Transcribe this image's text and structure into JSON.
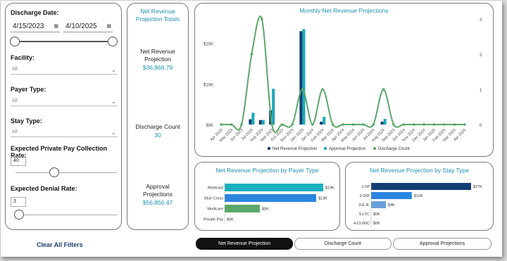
{
  "filters": {
    "discharge_date_label": "Discharge Date:",
    "start_date": "4/15/2023",
    "end_date": "4/10/2025",
    "facility_label": "Facility:",
    "facility_value": "All",
    "payer_label": "Payer Type:",
    "payer_value": "All",
    "stay_label": "Stay Type:",
    "stay_value": "All",
    "private_pay_label": "Expected Private Pay Collection Rate:",
    "private_pay_value": "40",
    "denial_label": "Expected Denial Rate:",
    "denial_value": "3",
    "clear_label": "Clear All Filters"
  },
  "totals": {
    "title": "Net Revenue Projection Totals",
    "nrp_label": "Net Revenue Projection",
    "nrp_value": "$36,868.79",
    "discharge_label": "Discharge Count",
    "discharge_value": "30",
    "approval_label": "Approval Projections",
    "approval_value": "$56,856.47"
  },
  "tabs": [
    "Net Revenue Projection",
    "Discharge Count",
    "Approval Projections"
  ],
  "colors": {
    "nrp": "#133e73",
    "approval": "#1aa8b8",
    "discharge": "#5aa86a",
    "accent": "#1a8fb0"
  },
  "chart_data": [
    {
      "type": "bar",
      "title": "Monthly Net Revenue Projections",
      "categories": [
        "Apr 2023",
        "May 2023",
        "Jun 2023",
        "Jul 2023",
        "Aug 2023",
        "Sep 2023",
        "Oct 2023",
        "Nov 2023",
        "Dec 2023",
        "Jan 2024",
        "Feb 2024",
        "Mar 2024",
        "Apr 2024",
        "May 2024",
        "Jun 2024",
        "Jul 2024",
        "Aug 2024",
        "Sep 2024",
        "Oct 2024",
        "Nov 2024",
        "Dec 2024",
        "Jan 2025",
        "Feb 2025",
        "Mar 2025",
        "Apr 2025"
      ],
      "series": [
        {
          "name": "Net Revenue Projection",
          "axis": "left",
          "values": [
            0,
            0,
            0,
            1300,
            1100,
            3500,
            0,
            0,
            23000,
            0,
            700,
            0,
            0,
            0,
            0,
            0,
            700,
            0,
            0,
            0,
            0,
            0,
            0,
            0,
            0
          ]
        },
        {
          "name": "Approval Projection",
          "axis": "left",
          "values": [
            0,
            0,
            0,
            2900,
            1100,
            8800,
            0,
            0,
            23500,
            0,
            1900,
            0,
            0,
            0,
            0,
            0,
            1400,
            0,
            0,
            0,
            0,
            0,
            0,
            0,
            0
          ]
        },
        {
          "name": "Discharge Count",
          "type": "line",
          "axis": "right",
          "values": [
            0,
            0,
            0,
            2,
            3,
            0,
            0,
            0,
            1,
            0,
            1,
            0,
            0,
            0,
            0,
            0,
            1,
            0,
            0,
            0,
            0,
            0,
            0,
            0,
            0
          ]
        }
      ],
      "left_ticks": [
        "$0K",
        "$10K",
        "$20K"
      ],
      "right_ticks": [
        "0",
        "1",
        "2",
        "3"
      ],
      "ylim": [
        0,
        26000
      ],
      "y2lim": [
        0,
        3
      ],
      "legend": "bottom"
    },
    {
      "type": "bar",
      "orientation": "horizontal",
      "title": "Net Revenue Projection by Payer Type",
      "categories": [
        "Medicaid",
        "Blue Cross",
        "Medicare",
        "Private Pay"
      ],
      "values": [
        14000,
        13000,
        5000,
        0
      ],
      "labels": [
        "$14K",
        "$13K",
        "$5K",
        "$0K"
      ],
      "colors": [
        "#1ab0c0",
        "#2b86e0",
        "#5aa86a",
        "#1ab0c0"
      ]
    },
    {
      "type": "bar",
      "orientation": "horizontal",
      "title": "Net Revenue Projection by Stay Type",
      "categories": [
        "1-I/P",
        "2-O/P",
        "3-E.R.",
        "5-LTC",
        "4-CLINIC"
      ],
      "values": [
        27000,
        11000,
        4000,
        0,
        0
      ],
      "labels": [
        "$27K",
        "$11K",
        "$4K",
        "$0K",
        "$0K"
      ],
      "colors": [
        "#133e73",
        "#2b86e0",
        "#6a9fd8",
        "#2b86e0",
        "#2b86e0"
      ]
    }
  ]
}
